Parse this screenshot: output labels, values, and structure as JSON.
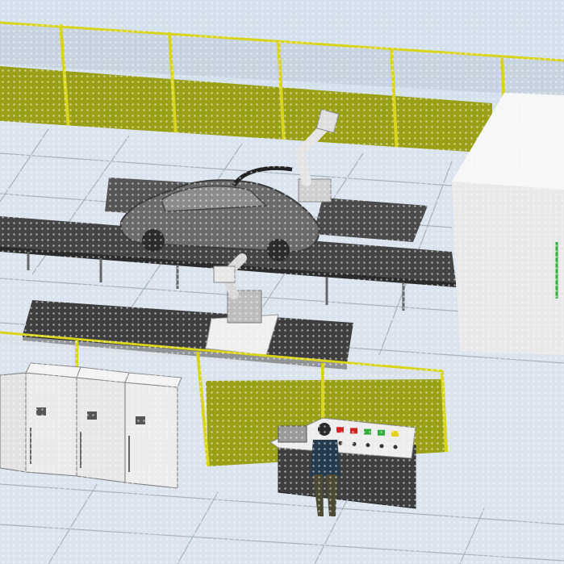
{
  "scene": {
    "description_label": "",
    "colors": {
      "sky": "#d4e0ec",
      "floor": "#dbe4ee",
      "floor_line": "#9aa6b2",
      "fence_panel": "#9aa016",
      "fence_post": "#d8d41c",
      "conveyor": "#444444",
      "robot": "#e4e4e4",
      "cabinet": "#e8e8e8",
      "enclosure": "#eeeeee",
      "operator_shirt": "#243a4e",
      "operator_pants": "#4d4a33"
    },
    "control_panel_lights": [
      "#d32020",
      "#d32020",
      "#d32020",
      "#2fae3a",
      "#2fae3a",
      "#e6d21c"
    ],
    "icons": [
      "robot-arm-icon",
      "car-body-icon",
      "conveyor-icon",
      "operator-icon",
      "control-panel-icon",
      "electrical-cabinet-icon",
      "safety-fence-icon"
    ]
  }
}
